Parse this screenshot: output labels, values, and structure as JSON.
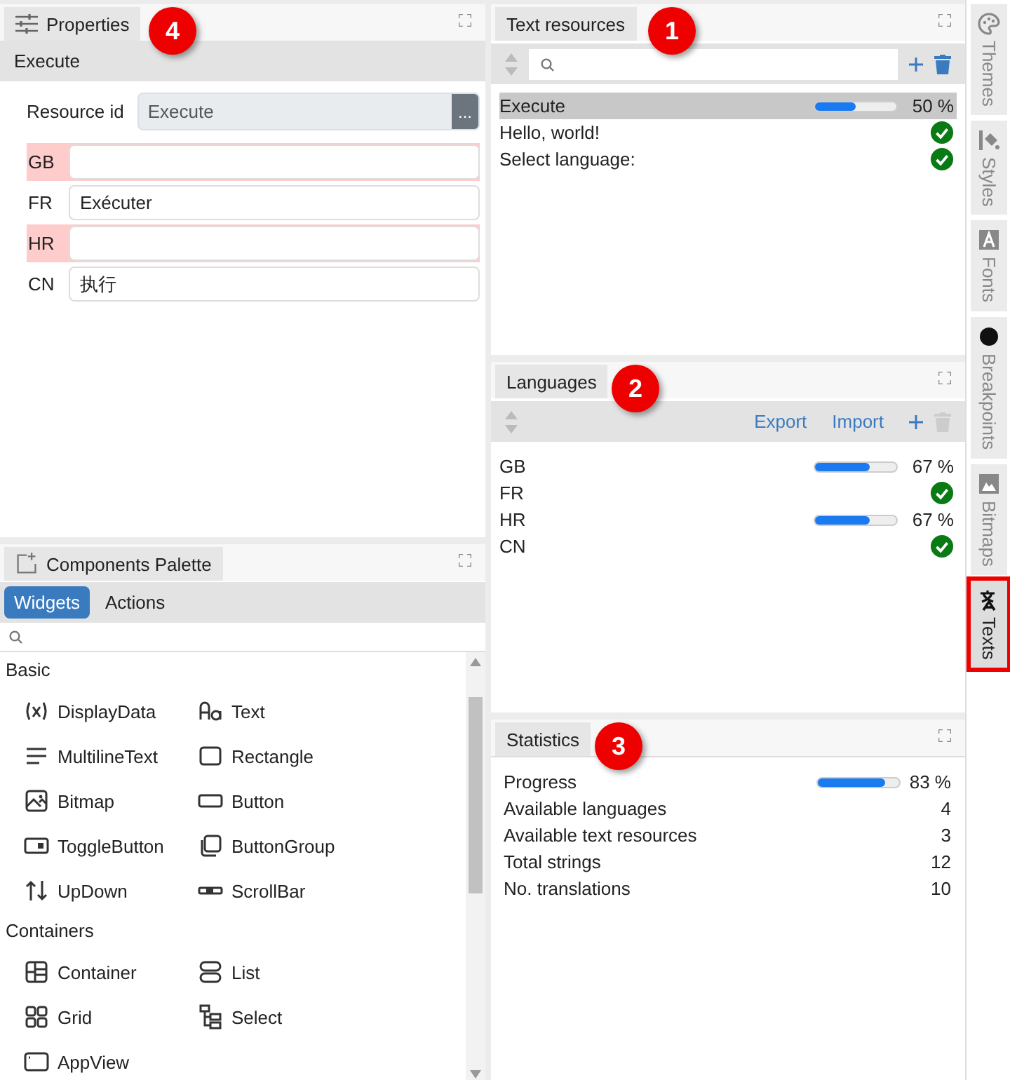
{
  "properties": {
    "title": "Properties",
    "badge": "4",
    "header": "Execute",
    "resource_id": {
      "label": "Resource id",
      "value": "Execute",
      "button": "..."
    },
    "translations": [
      {
        "lang": "GB",
        "missing": true
      },
      {
        "lang": "FR",
        "value": "Exécuter",
        "missing": false
      },
      {
        "lang": "HR",
        "missing": true
      },
      {
        "lang": "CN",
        "value": "执行",
        "missing": false
      }
    ]
  },
  "palette": {
    "title": "Components Palette",
    "tabs": [
      {
        "label": "Widgets",
        "selected": true
      },
      {
        "label": "Actions",
        "selected": false
      }
    ],
    "groups": [
      {
        "name": "Basic",
        "items": [
          {
            "label": "DisplayData"
          },
          {
            "label": "Text"
          },
          {
            "label": "MultilineText"
          },
          {
            "label": "Rectangle"
          },
          {
            "label": "Bitmap"
          },
          {
            "label": "Button"
          },
          {
            "label": "ToggleButton"
          },
          {
            "label": "ButtonGroup"
          },
          {
            "label": "UpDown"
          },
          {
            "label": "ScrollBar"
          }
        ]
      },
      {
        "name": "Containers",
        "items": [
          {
            "label": "Container"
          },
          {
            "label": "List"
          },
          {
            "label": "Grid"
          },
          {
            "label": "Select"
          },
          {
            "label": "AppView"
          }
        ]
      }
    ]
  },
  "text_resources": {
    "title": "Text resources",
    "badge": "1",
    "delete_disabled": false,
    "items": [
      {
        "name": "Execute",
        "selected": true,
        "complete": false,
        "level": 0.5,
        "percent": "50 %"
      },
      {
        "name": "Hello, world!",
        "selected": false,
        "complete": true
      },
      {
        "name": "Select language:",
        "selected": false,
        "complete": true
      }
    ]
  },
  "languages": {
    "title": "Languages",
    "badge": "2",
    "actions": [
      "Export",
      "Import"
    ],
    "delete_disabled": true,
    "items": [
      {
        "name": "GB",
        "selected": false,
        "complete": false,
        "level": 0.67,
        "percent": "67 %"
      },
      {
        "name": "FR",
        "selected": false,
        "complete": true
      },
      {
        "name": "HR",
        "selected": false,
        "complete": false,
        "level": 0.67,
        "percent": "67 %"
      },
      {
        "name": "CN",
        "selected": false,
        "complete": true
      }
    ]
  },
  "statistics": {
    "title": "Statistics",
    "badge": "3",
    "rows": [
      {
        "label": "Progress",
        "kind": "progress",
        "level": 0.83,
        "value": "83 %"
      },
      {
        "label": "Available languages",
        "kind": "number",
        "value": "4"
      },
      {
        "label": "Available text resources",
        "kind": "number",
        "value": "3"
      },
      {
        "label": "Total strings",
        "kind": "number",
        "value": "12"
      },
      {
        "label": "No. translations",
        "kind": "number",
        "value": "10"
      }
    ]
  },
  "side_tabs": [
    {
      "label": "Themes",
      "selected": false
    },
    {
      "label": "Styles",
      "selected": false
    },
    {
      "label": "Fonts",
      "selected": false
    },
    {
      "label": "Breakpoints",
      "selected": false
    },
    {
      "label": "Bitmaps",
      "selected": false
    },
    {
      "label": "Texts",
      "selected": true
    }
  ]
}
